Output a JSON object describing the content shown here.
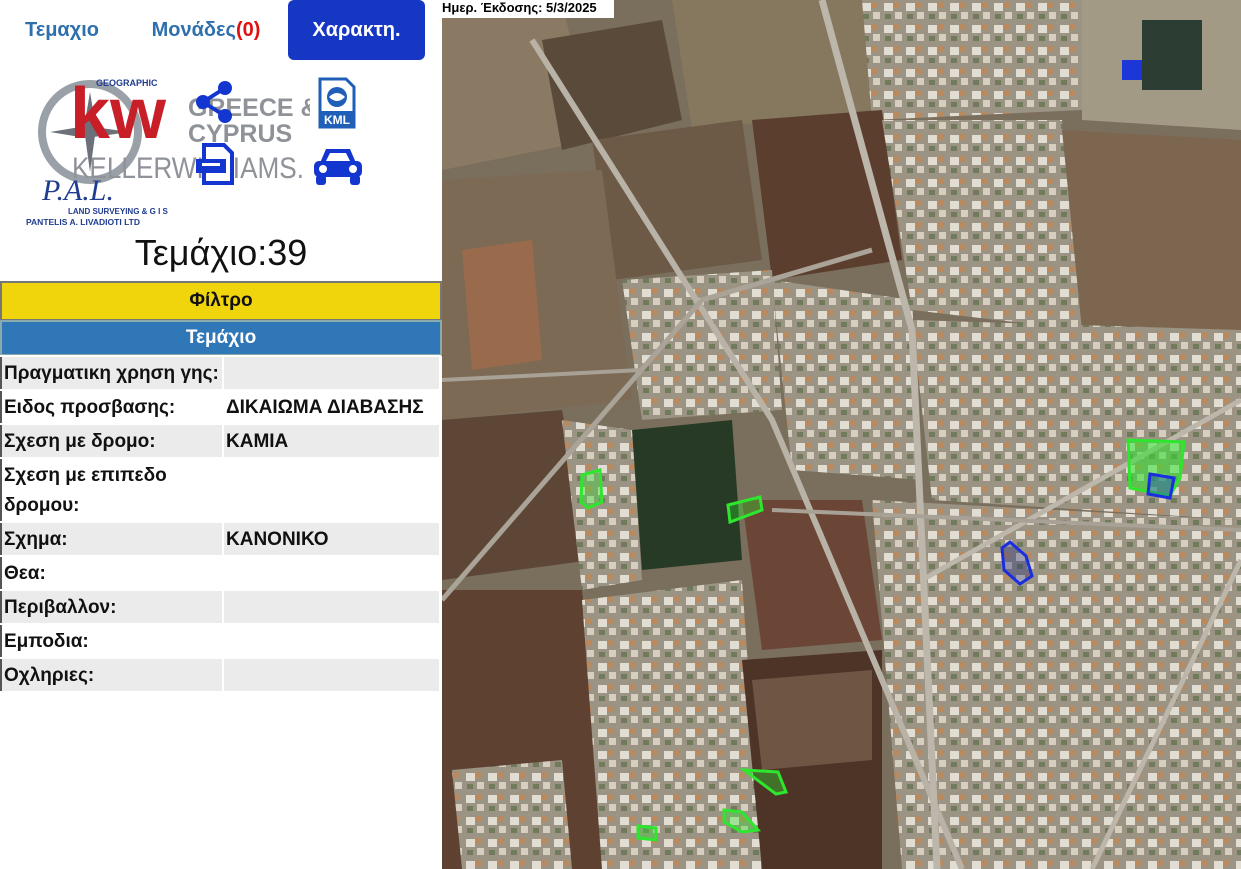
{
  "tabs": {
    "parcel": "Τεμαχιο",
    "units": "Μονάδες",
    "units_count": "(0)",
    "characteristics": "Χαρακτη."
  },
  "logos": {
    "pal_name": "P.A.L.",
    "pal_sub": "LAND SURVEYING & G I S",
    "pal_company": "PANTELIS A. LIVADIOTI LTD",
    "pal_ring": "GEOGRAPHIC",
    "kw_mark": "kw",
    "kw_region_1": "GREECE &",
    "kw_region_2": "CYPRUS",
    "kw_name": "KELLERWILLIAMS."
  },
  "icons": {
    "share": "share-icon",
    "kml": "kml-icon",
    "kml_label": "KML",
    "pdf": "pdf-icon",
    "car": "car-icon"
  },
  "parcel_title": "Τεμάχιο:39",
  "filter_label": "Φίλτρο",
  "section_header": "Τεμάχιο",
  "attributes": [
    {
      "label": "Πραγματικη χρηση γης:",
      "value": ""
    },
    {
      "label": "Ειδος προσβασης:",
      "value": "ΔΙΚΑΙΩΜΑ ΔΙΑΒΑΣΗΣ"
    },
    {
      "label": "Σχεση με δρομο:",
      "value": "ΚΑΜΙΑ"
    },
    {
      "label": "Σχεση με επιπεδο δρομου:",
      "value": ""
    },
    {
      "label": "Σχημα:",
      "value": "ΚΑΝΟΝΙΚΟ"
    },
    {
      "label": "Θεα:",
      "value": ""
    },
    {
      "label": "Περιβαλλον:",
      "value": ""
    },
    {
      "label": "Εμποδια:",
      "value": ""
    },
    {
      "label": "Οχληριες:",
      "value": ""
    }
  ],
  "map": {
    "issue_date": "Ημερ. Έκδοσης: 5/3/2025",
    "colors": {
      "green_parcel": "#2ee62e",
      "blue_parcel": "#1a2ee0"
    }
  },
  "colors": {
    "tab_text": "#2e6fad",
    "active_tab_bg": "#1636c4",
    "units_count": "#e01010",
    "filter_bg": "#f0d50c",
    "section_bg": "#2f77b7"
  }
}
